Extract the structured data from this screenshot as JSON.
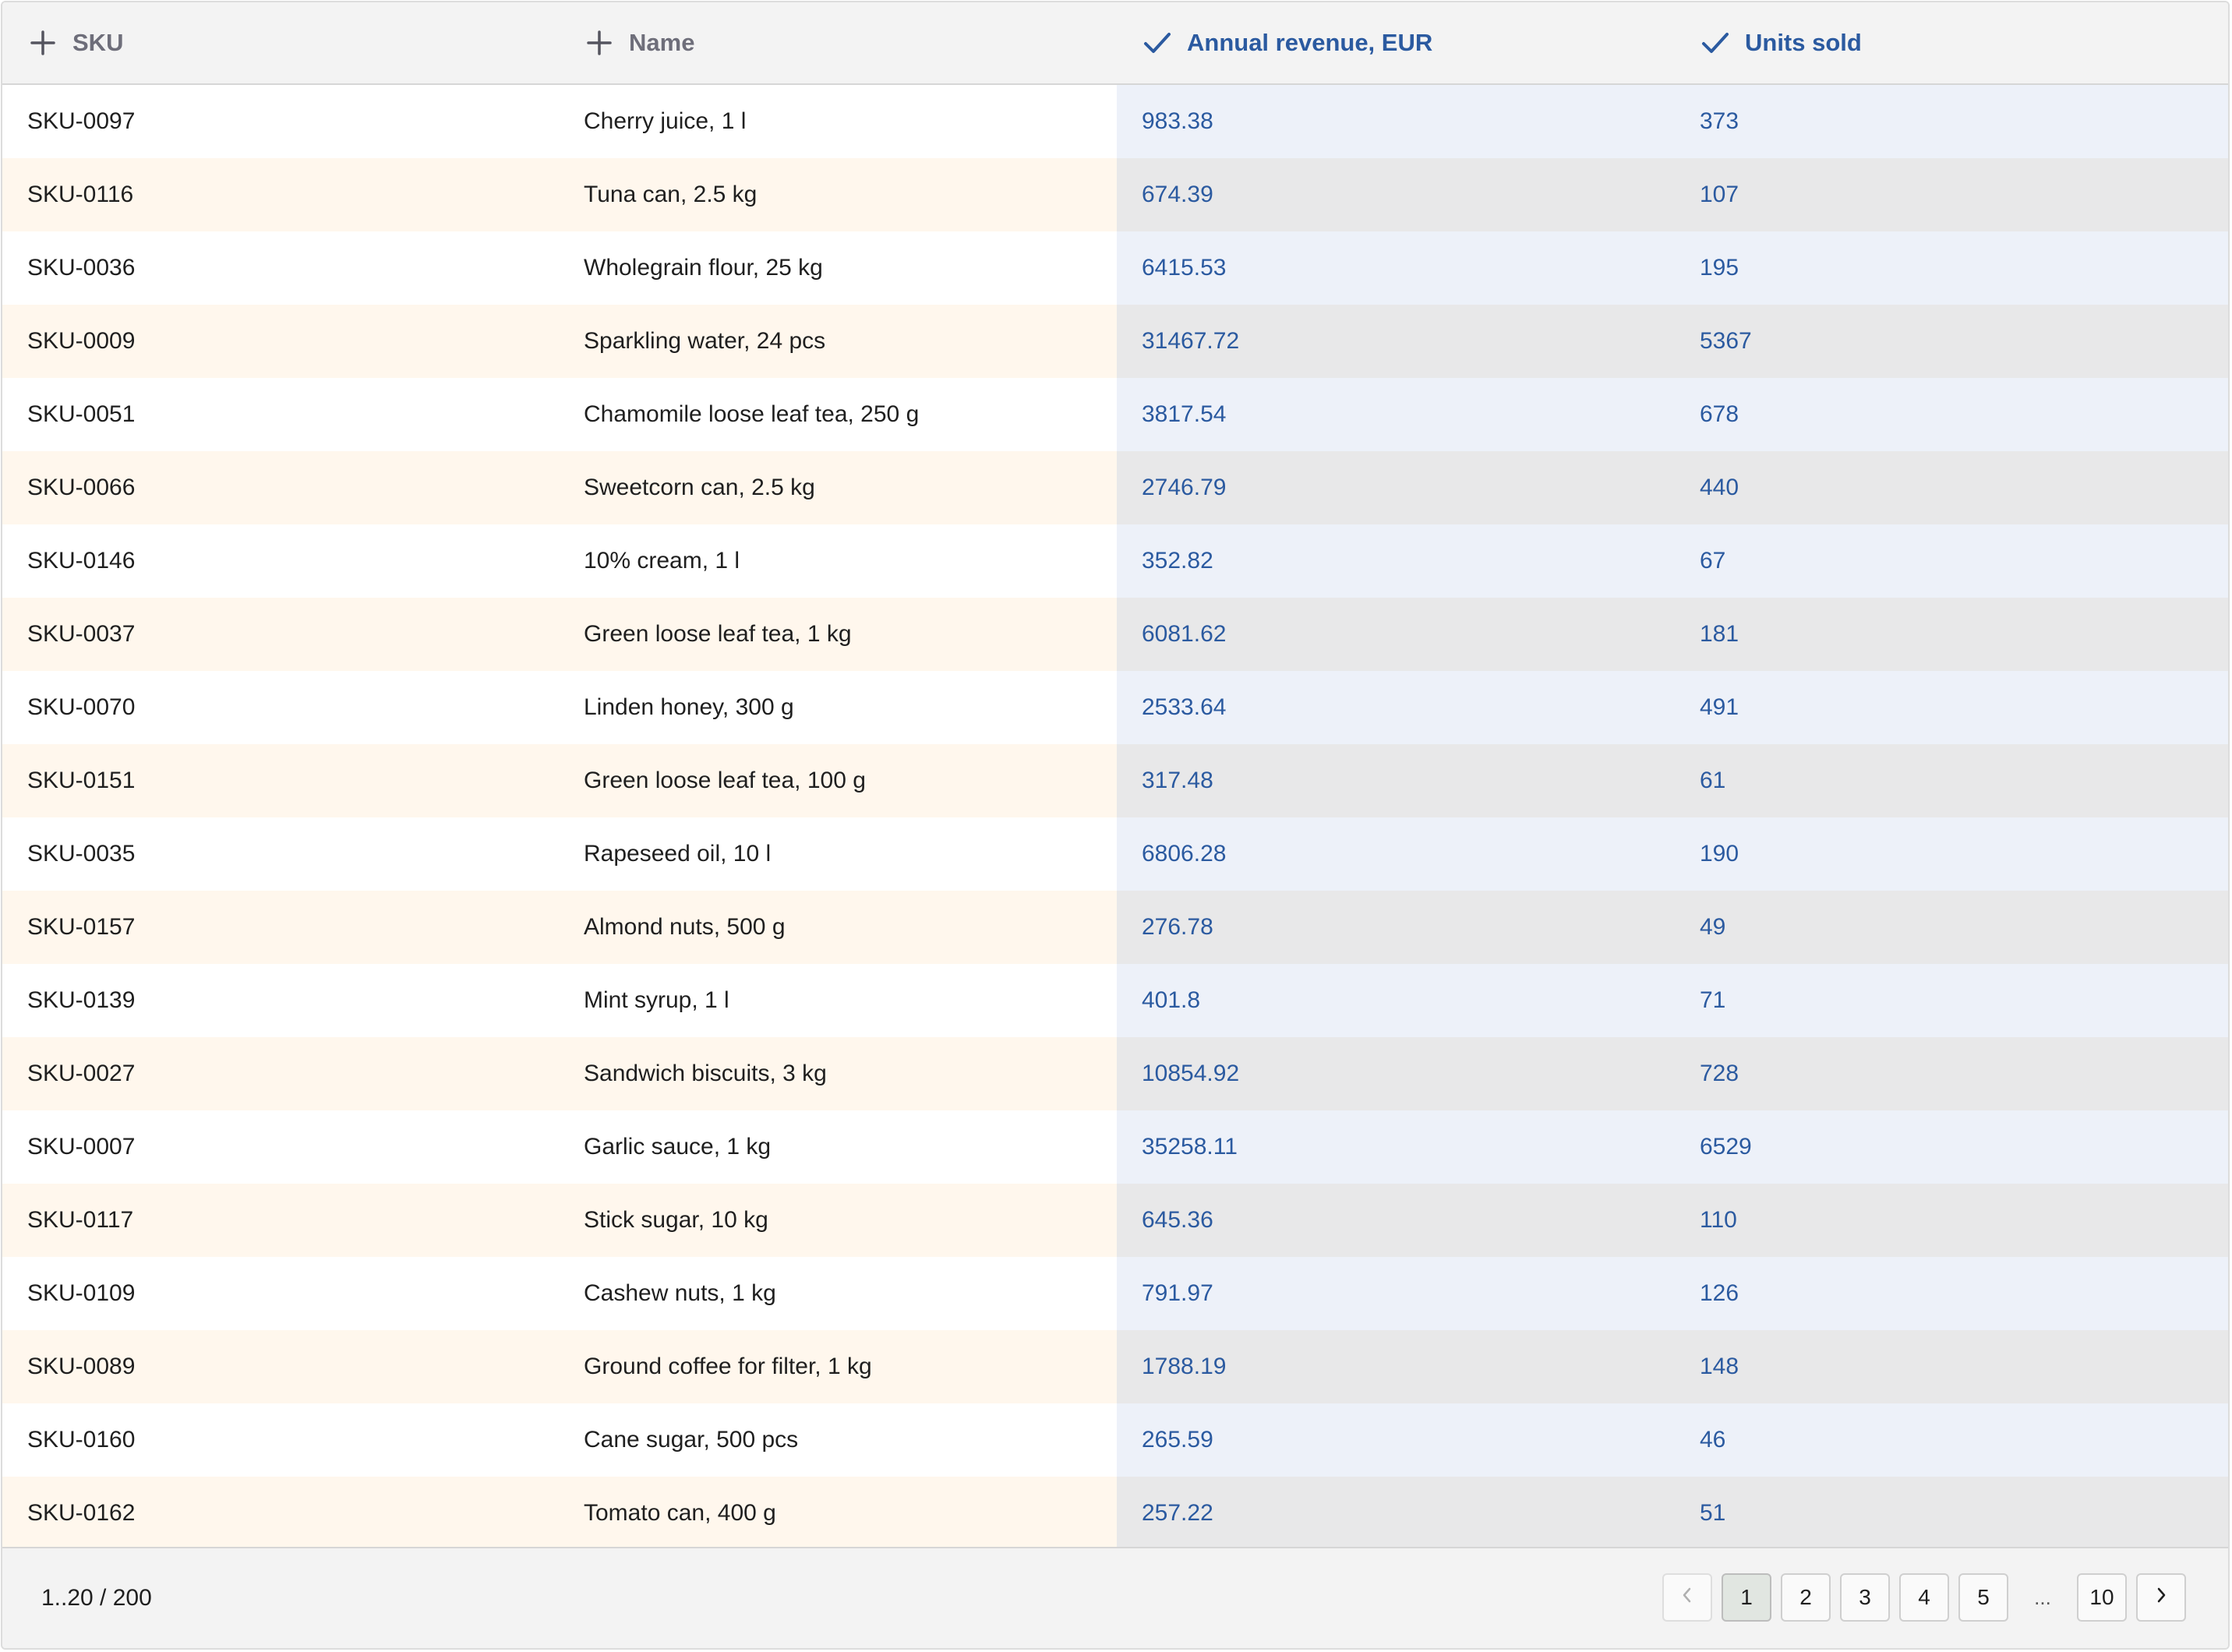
{
  "columns": [
    {
      "label": "SKU",
      "state": "add"
    },
    {
      "label": "Name",
      "state": "add"
    },
    {
      "label": "Annual revenue, EUR",
      "state": "selected"
    },
    {
      "label": "Units sold",
      "state": "selected"
    }
  ],
  "rows": [
    {
      "sku": "SKU-0097",
      "name": "Cherry juice, 1 l",
      "revenue": "983.38",
      "units": "373"
    },
    {
      "sku": "SKU-0116",
      "name": "Tuna can, 2.5 kg",
      "revenue": "674.39",
      "units": "107"
    },
    {
      "sku": "SKU-0036",
      "name": "Wholegrain flour, 25 kg",
      "revenue": "6415.53",
      "units": "195"
    },
    {
      "sku": "SKU-0009",
      "name": "Sparkling water, 24 pcs",
      "revenue": "31467.72",
      "units": "5367"
    },
    {
      "sku": "SKU-0051",
      "name": "Chamomile loose leaf tea, 250 g",
      "revenue": "3817.54",
      "units": "678"
    },
    {
      "sku": "SKU-0066",
      "name": "Sweetcorn can, 2.5 kg",
      "revenue": "2746.79",
      "units": "440"
    },
    {
      "sku": "SKU-0146",
      "name": "10% cream, 1 l",
      "revenue": "352.82",
      "units": "67"
    },
    {
      "sku": "SKU-0037",
      "name": "Green loose leaf tea, 1 kg",
      "revenue": "6081.62",
      "units": "181"
    },
    {
      "sku": "SKU-0070",
      "name": "Linden honey, 300 g",
      "revenue": "2533.64",
      "units": "491"
    },
    {
      "sku": "SKU-0151",
      "name": "Green loose leaf tea, 100 g",
      "revenue": "317.48",
      "units": "61"
    },
    {
      "sku": "SKU-0035",
      "name": "Rapeseed oil, 10 l",
      "revenue": "6806.28",
      "units": "190"
    },
    {
      "sku": "SKU-0157",
      "name": "Almond nuts, 500 g",
      "revenue": "276.78",
      "units": "49"
    },
    {
      "sku": "SKU-0139",
      "name": "Mint syrup, 1 l",
      "revenue": "401.8",
      "units": "71"
    },
    {
      "sku": "SKU-0027",
      "name": "Sandwich biscuits, 3 kg",
      "revenue": "10854.92",
      "units": "728"
    },
    {
      "sku": "SKU-0007",
      "name": "Garlic sauce, 1 kg",
      "revenue": "35258.11",
      "units": "6529"
    },
    {
      "sku": "SKU-0117",
      "name": "Stick sugar, 10 kg",
      "revenue": "645.36",
      "units": "110"
    },
    {
      "sku": "SKU-0109",
      "name": "Cashew nuts, 1 kg",
      "revenue": "791.97",
      "units": "126"
    },
    {
      "sku": "SKU-0089",
      "name": "Ground coffee for filter, 1 kg",
      "revenue": "1788.19",
      "units": "148"
    },
    {
      "sku": "SKU-0160",
      "name": "Cane sugar, 500 pcs",
      "revenue": "265.59",
      "units": "46"
    },
    {
      "sku": "SKU-0162",
      "name": "Tomato can, 400 g",
      "revenue": "257.22",
      "units": "51"
    }
  ],
  "footer": {
    "range": "1..20 / 200",
    "pages": [
      "1",
      "2",
      "3",
      "4",
      "5"
    ],
    "ellipsis": "...",
    "last_page": "10",
    "current_page": "1",
    "prev_icon": "chevron-left-icon",
    "next_icon": "chevron-right-icon"
  },
  "colors": {
    "accent": "#2b5aa0",
    "header_bg": "#f3f3f3",
    "row_alt_bg": "#fff7ed",
    "selected_col_bg": "#edf1f9",
    "selected_col_alt_bg": "#e8e8e9"
  }
}
